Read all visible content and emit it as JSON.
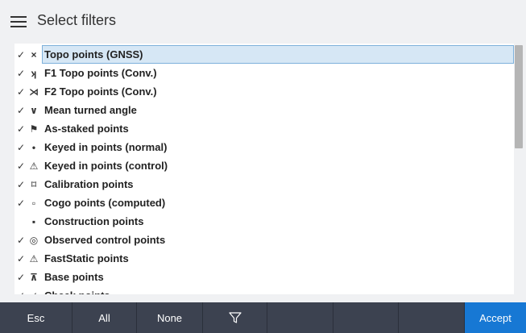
{
  "header": {
    "title": "Select filters"
  },
  "list": {
    "items": [
      {
        "checked": "✓",
        "symbol": "×",
        "label": "Topo points (GNSS)",
        "selected": true
      },
      {
        "checked": "✓",
        "symbol": "ʞ",
        "label": "F1 Topo points (Conv.)"
      },
      {
        "checked": "✓",
        "symbol": "⋊",
        "label": "F2 Topo points (Conv.)"
      },
      {
        "checked": "✓",
        "symbol": "∨",
        "label": "Mean turned angle"
      },
      {
        "checked": "✓",
        "symbol": "⚑",
        "label": "As-staked points"
      },
      {
        "checked": "✓",
        "symbol": "•",
        "label": "Keyed in points (normal)"
      },
      {
        "checked": "✓",
        "symbol": "⚠",
        "label": "Keyed in points (control)"
      },
      {
        "checked": "✓",
        "symbol": "⌑",
        "label": "Calibration points"
      },
      {
        "checked": "✓",
        "symbol": "▫",
        "label": "Cogo points (computed)"
      },
      {
        "checked": "",
        "symbol": "▪",
        "label": "Construction points"
      },
      {
        "checked": "✓",
        "symbol": "◎",
        "label": "Observed control points"
      },
      {
        "checked": "✓",
        "symbol": "⚠",
        "label": "FastStatic points"
      },
      {
        "checked": "✓",
        "symbol": "⊼",
        "label": "Base points"
      },
      {
        "checked": "✓",
        "symbol": "✓",
        "label": "Check points"
      }
    ]
  },
  "toolbar": {
    "esc_label": "Esc",
    "all_label": "All",
    "none_label": "None",
    "filter_icon": "funnel-icon",
    "accept_label": "Accept",
    "accent_color": "#1778d4"
  }
}
